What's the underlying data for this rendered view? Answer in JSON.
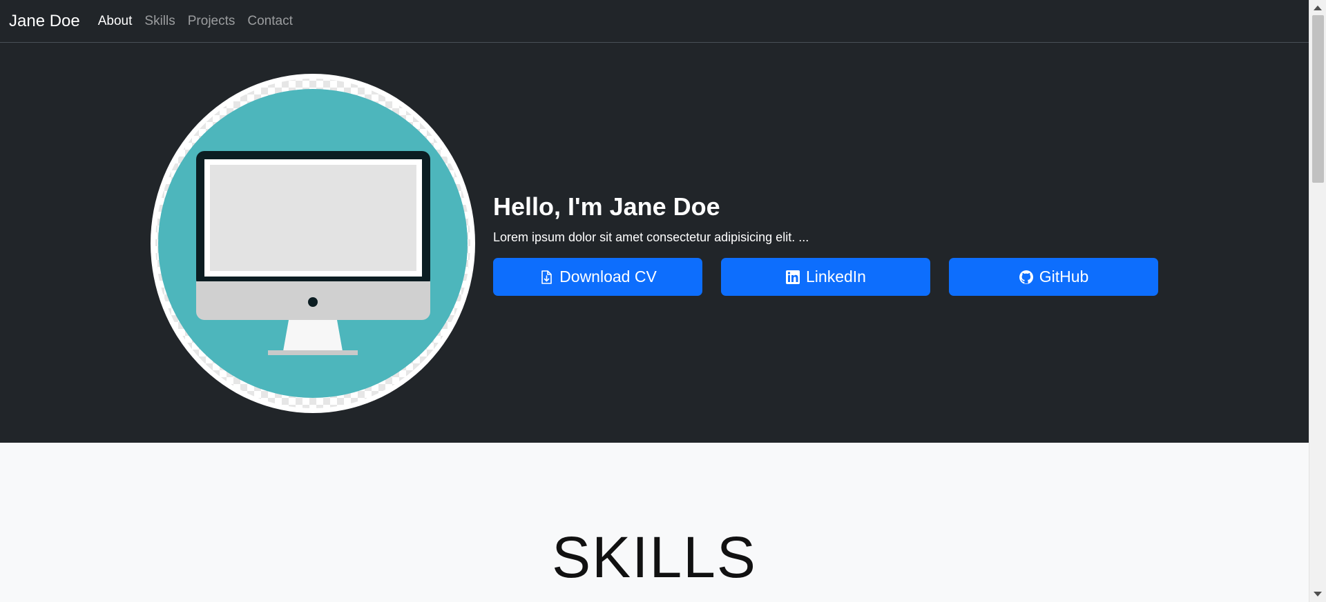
{
  "nav": {
    "brand": "Jane Doe",
    "links": [
      {
        "label": "About",
        "active": true
      },
      {
        "label": "Skills",
        "active": false
      },
      {
        "label": "Projects",
        "active": false
      },
      {
        "label": "Contact",
        "active": false
      }
    ]
  },
  "hero": {
    "title": "Hello, I'm Jane Doe",
    "subtitle": "Lorem ipsum dolor sit amet consectetur adipisicing elit. ...",
    "avatar_icon": "desktop-computer-icon",
    "buttons": [
      {
        "label": "Download CV",
        "icon": "file-download-icon"
      },
      {
        "label": "LinkedIn",
        "icon": "linkedin-icon"
      },
      {
        "label": "GitHub",
        "icon": "github-icon"
      }
    ]
  },
  "skills": {
    "title": "SKILLS"
  },
  "colors": {
    "nav_bg": "#212529",
    "accent": "#0d6efd",
    "avatar_bg": "#4db6bc",
    "section_bg": "#f8f9fa"
  }
}
